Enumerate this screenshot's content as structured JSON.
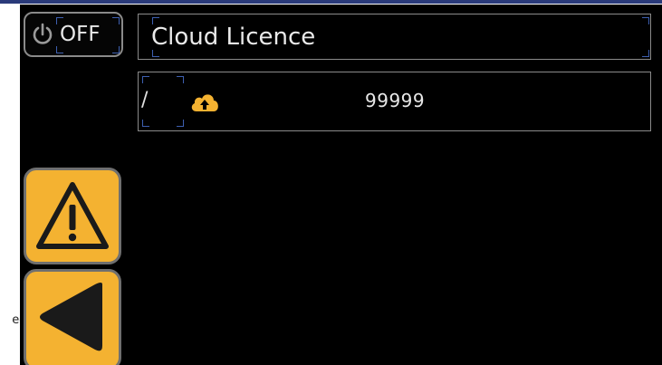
{
  "header": {
    "power_label": "OFF",
    "title": "Cloud Licence"
  },
  "row": {
    "prefix": "/",
    "icon": "cloud-upload-icon",
    "value": "99999"
  },
  "side_text": "e-",
  "colors": {
    "accent": "#f4b231",
    "background": "#000000",
    "border": "#8a8a8a",
    "bracket": "#3d5fb0",
    "top_strip": "#2a3a7a"
  },
  "nav": {
    "warning_icon": "warning-icon",
    "back_icon": "back-arrow-icon"
  }
}
